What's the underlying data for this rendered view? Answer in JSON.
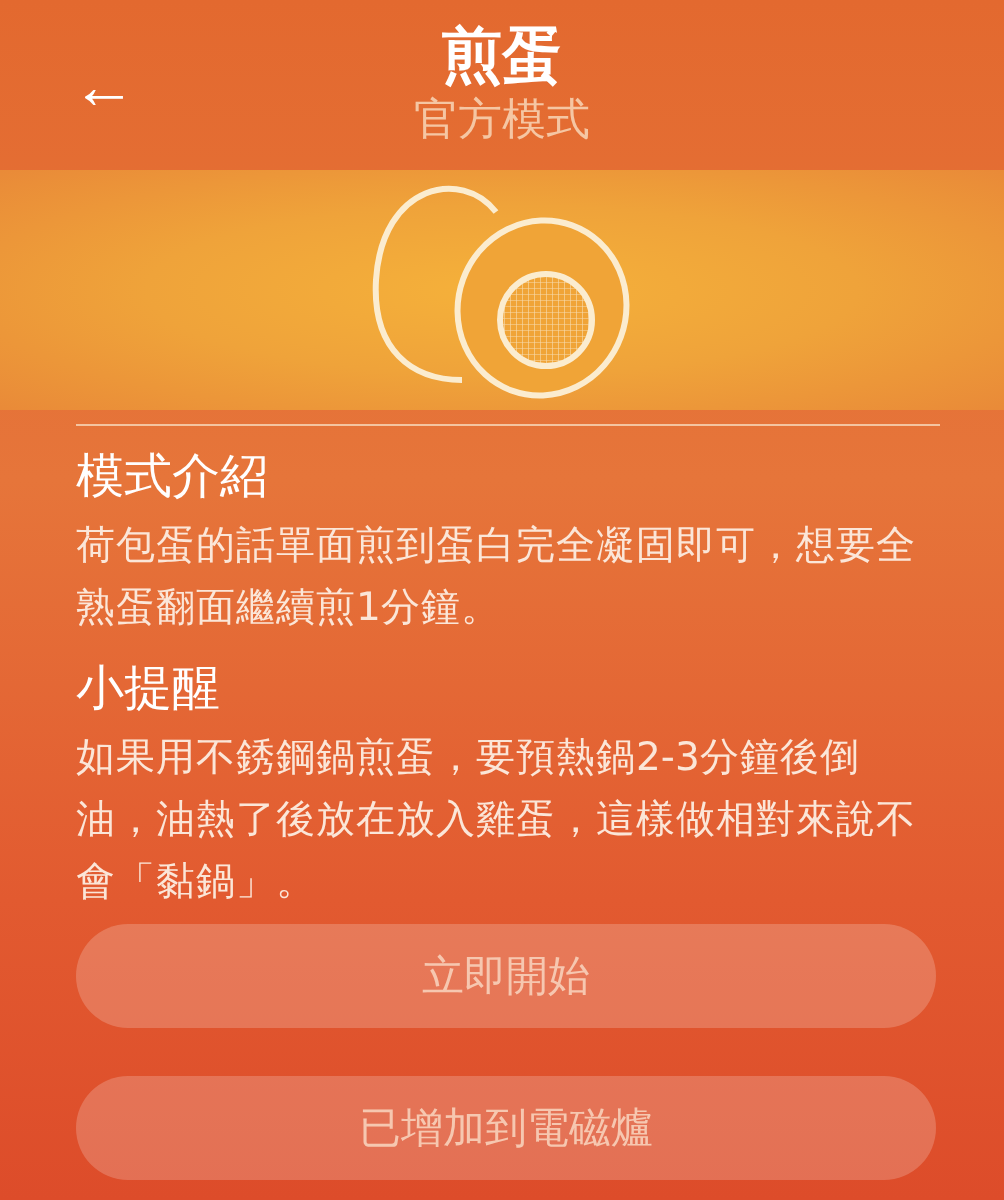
{
  "header": {
    "back_icon": "←",
    "title": "煎蛋",
    "subtitle": "官方模式"
  },
  "sections": [
    {
      "heading": "模式介紹",
      "body": "荷包蛋的話單面煎到蛋白完全凝固即可，想要全熟蛋翻面繼續煎1分鐘。"
    },
    {
      "heading": "小提醒",
      "body": "如果用不銹鋼鍋煎蛋，要預熱鍋2-3分鐘後倒油，油熱了後放在放入雞蛋，這樣做相對來說不會「黏鍋」。"
    }
  ],
  "buttons": [
    "立即開始",
    "已增加到電磁爐"
  ]
}
